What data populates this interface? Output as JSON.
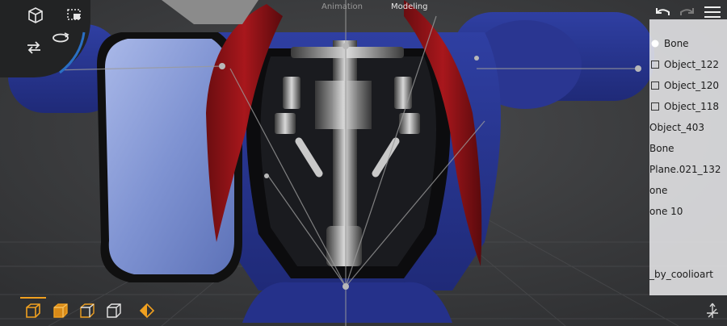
{
  "colors": {
    "accent": "#f0a020",
    "outliner_bg": "#e6e6e8",
    "toolbar_bg": "#222324"
  },
  "mode_tabs": [
    {
      "label": "Animation",
      "active": false
    },
    {
      "label": "Modeling",
      "active": true
    }
  ],
  "toolbar": {
    "icons": [
      "cube-icon",
      "box-select-icon",
      "swap-arrows-icon",
      "orbit-icon"
    ]
  },
  "top_right": {
    "icons": [
      "undo-icon",
      "redo-icon",
      "menu-icon"
    ],
    "redo_enabled": false
  },
  "outliner": {
    "items": [
      {
        "label": "Bone",
        "icon": "circle-icon"
      },
      {
        "label": "Object_122",
        "icon": "square-icon"
      },
      {
        "label": "Object_120",
        "icon": "square-icon"
      },
      {
        "label": "Object_118",
        "icon": "square-icon"
      },
      {
        "label": "Object_403",
        "icon": ""
      },
      {
        "label": "Bone",
        "icon": ""
      },
      {
        "label": "Plane.021_132",
        "icon": ""
      },
      {
        "label": "one",
        "icon": ""
      },
      {
        "label": "one 10",
        "icon": ""
      },
      {
        "label": "_by_coolioart",
        "icon": ""
      }
    ]
  },
  "bottom_bar": {
    "icons": [
      "cube-solid-icon",
      "cube-shaded-icon",
      "cube-outline-icon",
      "cube-wire-icon",
      "keyframe-icon",
      "transform-gizmo-icon"
    ]
  }
}
